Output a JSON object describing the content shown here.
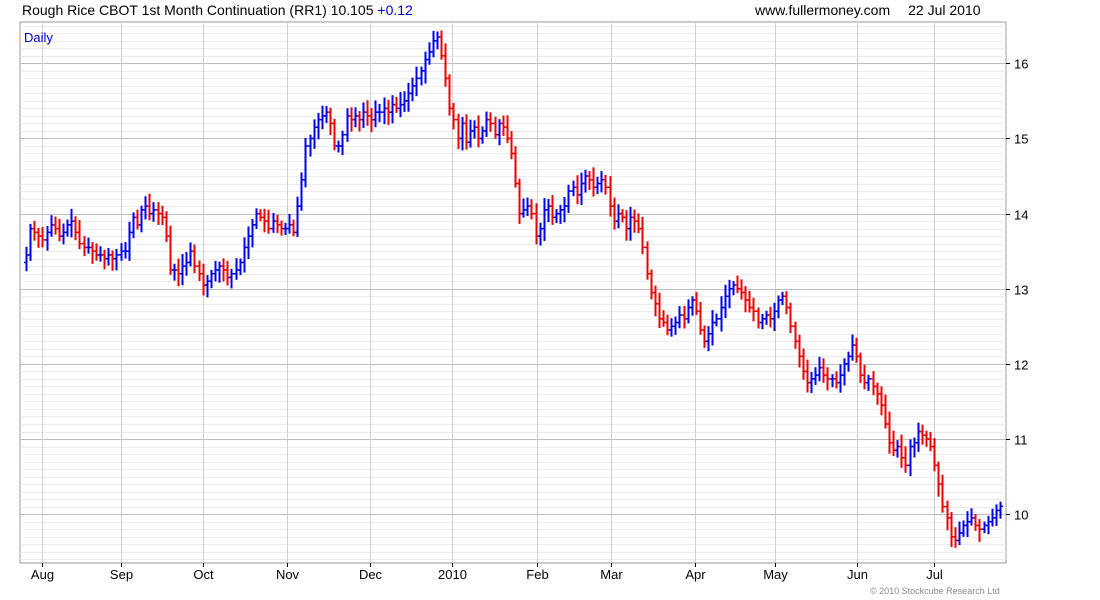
{
  "header": {
    "title": "Rough Rice CBOT 1st Month Continuation (RR1)",
    "last": "10.105",
    "change": "+0.12",
    "site": "www.fullermoney.com",
    "date": "22 Jul 2010"
  },
  "copyright": "© 2010 Stockcube Research Ltd",
  "colors": {
    "up": "#0000ee",
    "down": "#ee0000",
    "grid": "#d0d0d0",
    "grid_major": "#bdbdbd",
    "frame": "#9a9a9a"
  },
  "chart_data": {
    "type": "ohlc",
    "interval_label": "Daily",
    "ylim": [
      9.35,
      16.55
    ],
    "yticks": [
      10,
      11,
      12,
      13,
      14,
      15,
      16
    ],
    "xlabels": [
      "Aug",
      "Sep",
      "Oct",
      "Nov",
      "Dec",
      "2010",
      "Feb",
      "Mar",
      "Apr",
      "May",
      "Jun",
      "Jul"
    ],
    "series": [
      {
        "values": [
          13.45,
          13.8,
          13.75,
          13.7,
          13.65,
          13.75,
          13.85,
          13.8,
          13.7,
          13.75,
          13.85,
          13.9,
          13.75,
          13.6,
          13.55,
          13.55,
          13.5,
          13.45,
          13.45,
          13.4,
          13.45,
          13.4,
          13.45,
          13.5,
          13.5,
          13.75,
          13.95,
          13.85,
          14.05,
          14.1,
          14.0,
          14.05,
          14.0,
          13.95,
          13.7,
          13.25,
          13.25,
          13.2,
          13.3,
          13.35,
          13.5,
          13.3,
          13.2,
          13.05,
          13.1,
          13.2,
          13.25,
          13.3,
          13.25,
          13.15,
          13.2,
          13.25,
          13.35,
          13.55,
          13.7,
          13.85,
          14.0,
          13.95,
          13.9,
          13.8,
          13.9,
          13.85,
          13.8,
          13.8,
          13.85,
          13.75,
          14.1,
          14.45,
          14.9,
          15.0,
          15.15,
          15.25,
          15.3,
          15.35,
          15.2,
          14.9,
          14.9,
          15.05,
          15.3,
          15.25,
          15.3,
          15.25,
          15.35,
          15.3,
          15.25,
          15.35,
          15.35,
          15.4,
          15.35,
          15.45,
          15.4,
          15.45,
          15.5,
          15.6,
          15.7,
          15.8,
          15.9,
          16.05,
          16.15,
          16.3,
          16.35,
          16.1,
          15.8,
          15.4,
          15.25,
          15.0,
          15.2,
          14.95,
          15.1,
          15.15,
          15.0,
          15.1,
          15.25,
          15.2,
          15.05,
          15.2,
          15.15,
          15.0,
          14.8,
          14.4,
          14.0,
          14.05,
          14.1,
          14.0,
          13.7,
          13.8,
          14.05,
          14.1,
          13.95,
          14.0,
          14.05,
          14.1,
          14.3,
          14.35,
          14.25,
          14.4,
          14.5,
          14.45,
          14.35,
          14.4,
          14.45,
          14.35,
          14.1,
          13.9,
          14.0,
          13.95,
          13.8,
          13.95,
          13.9,
          13.8,
          13.55,
          13.2,
          12.95,
          12.8,
          12.6,
          12.55,
          12.45,
          12.5,
          12.55,
          12.65,
          12.6,
          12.75,
          12.85,
          12.7,
          12.45,
          12.3,
          12.4,
          12.55,
          12.6,
          12.75,
          12.9,
          13.0,
          13.05,
          13.0,
          12.95,
          12.85,
          12.75,
          12.7,
          12.55,
          12.6,
          12.65,
          12.6,
          12.7,
          12.85,
          12.9,
          12.75,
          12.5,
          12.3,
          12.1,
          11.9,
          11.75,
          11.8,
          11.85,
          11.95,
          11.85,
          11.8,
          11.8,
          11.75,
          11.85,
          12.0,
          12.1,
          12.25,
          12.1,
          11.85,
          11.75,
          11.8,
          11.7,
          11.6,
          11.45,
          11.2,
          10.95,
          10.85,
          10.9,
          10.75,
          10.65,
          10.9,
          10.95,
          11.1,
          11.05,
          11.0,
          10.9,
          10.65,
          10.4,
          10.1,
          9.95,
          9.7,
          9.65,
          9.75,
          9.85,
          9.9,
          9.95,
          9.85,
          9.8,
          9.85,
          9.9,
          9.95,
          10.05,
          10.105
        ]
      }
    ]
  }
}
